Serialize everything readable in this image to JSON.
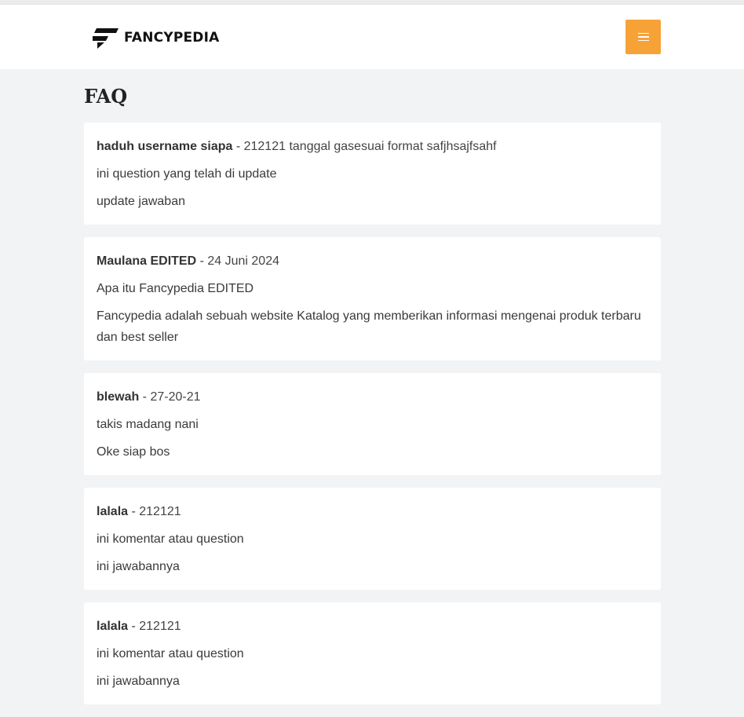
{
  "header": {
    "logo_text": "FANCYPEDIA",
    "accent_color": "#f7a236"
  },
  "page": {
    "title": "FAQ"
  },
  "faq": [
    {
      "author": "haduh username siapa",
      "date": "212121 tanggal gasesuai format safjhsajfsahf",
      "question": "ini question yang telah di update",
      "answer": "update jawaban"
    },
    {
      "author": "Maulana EDITED",
      "date": "24 Juni 2024",
      "question": "Apa itu Fancypedia EDITED",
      "answer": "Fancypedia adalah sebuah website Katalog yang memberikan informasi mengenai produk terbaru dan best seller"
    },
    {
      "author": "blewah",
      "date": "27-20-21",
      "question": "takis madang nani",
      "answer": "Oke siap bos"
    },
    {
      "author": "lalala",
      "date": "212121",
      "question": "ini komentar atau question",
      "answer": "ini jawabannya"
    },
    {
      "author": "lalala",
      "date": "212121",
      "question": "ini komentar atau question",
      "answer": "ini jawabannya"
    }
  ]
}
